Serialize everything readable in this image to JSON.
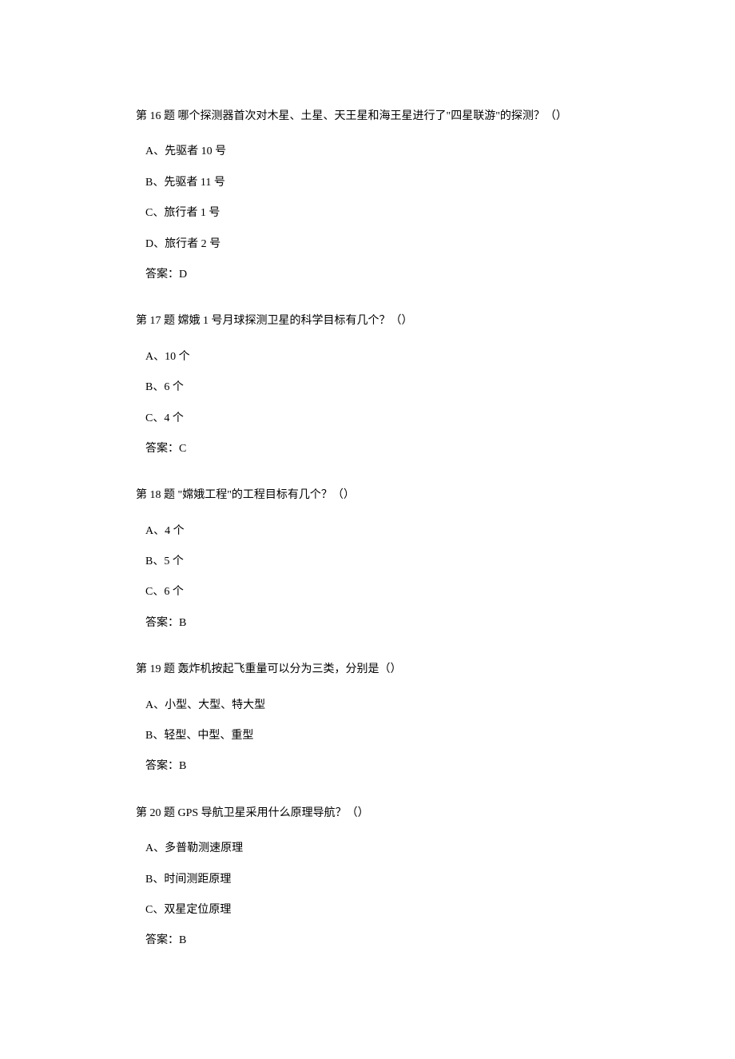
{
  "questions": [
    {
      "title": "第 16 题 哪个探测器首次对木星、土星、天王星和海王星进行了\"四星联游\"的探测？（）",
      "options": [
        "A、先驱者 10 号",
        "B、先驱者 11 号",
        "C、旅行者 1 号",
        "D、旅行者 2 号"
      ],
      "answer": "答案：D"
    },
    {
      "title": "第 17 题 嫦娥 1 号月球探测卫星的科学目标有几个？（）",
      "options": [
        "A、10 个",
        "B、6 个",
        "C、4 个"
      ],
      "answer": "答案：C"
    },
    {
      "title": "第 18 题 \"嫦娥工程\"的工程目标有几个？（）",
      "options": [
        "A、4 个",
        "B、5 个",
        "C、6 个"
      ],
      "answer": "答案：B"
    },
    {
      "title": "第 19 题 轰炸机按起飞重量可以分为三类，分别是（）",
      "options": [
        "A、小型、大型、特大型",
        "B、轻型、中型、重型"
      ],
      "answer": "答案：B"
    },
    {
      "title": "第 20 题 GPS 导航卫星采用什么原理导航？（）",
      "options": [
        "A、多普勒测速原理",
        "B、时间测距原理",
        "C、双星定位原理"
      ],
      "answer": "答案：B"
    }
  ]
}
